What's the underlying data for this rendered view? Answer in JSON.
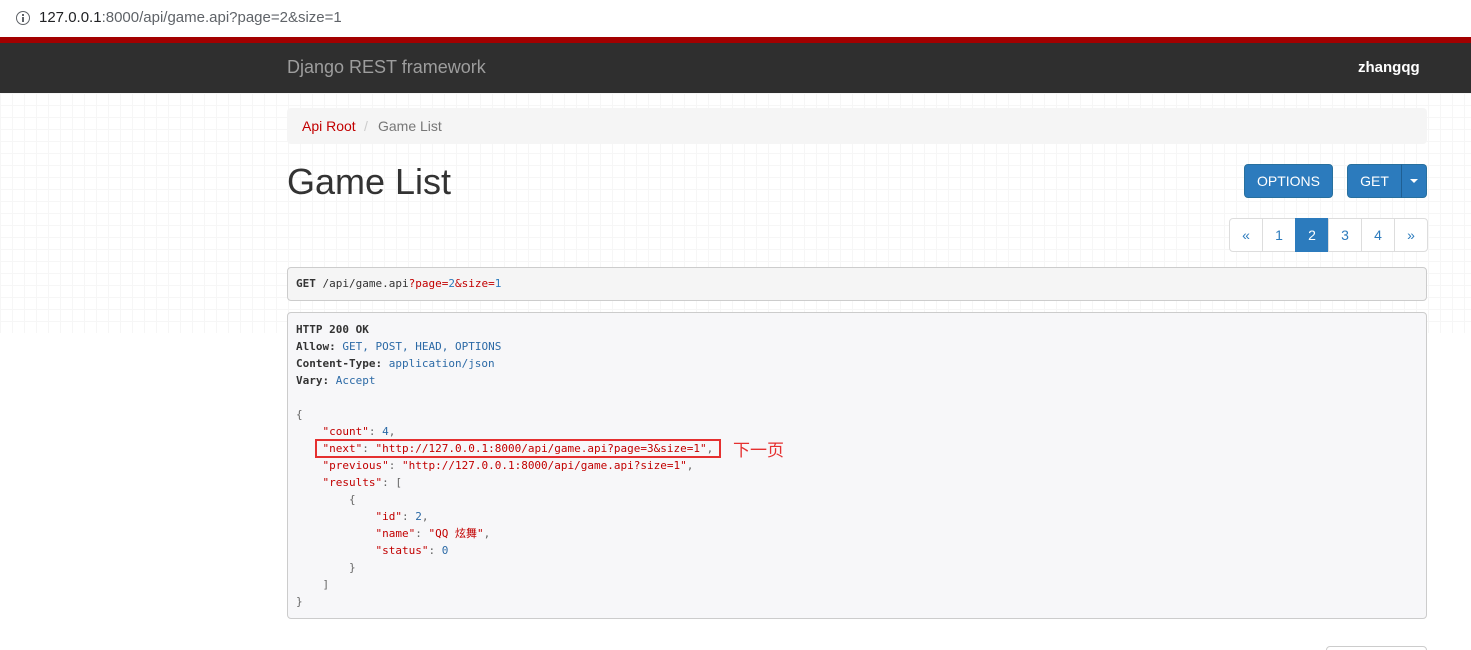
{
  "browser": {
    "url_host": "127.0.0.1",
    "url_rest": ":8000/api/game.api?page=2&size=1"
  },
  "navbar": {
    "brand": "Django REST framework",
    "user": "zhangqg"
  },
  "breadcrumb": {
    "root": "Api Root",
    "separator": "/",
    "current": "Game List"
  },
  "page": {
    "title": "Game List"
  },
  "buttons": {
    "options": "OPTIONS",
    "get": "GET"
  },
  "pagination": {
    "items": [
      "«",
      "1",
      "2",
      "3",
      "4",
      "»"
    ],
    "active": "2"
  },
  "request": {
    "method": "GET",
    "path": "/api/game.api",
    "q1": "?page=",
    "v1": "2",
    "q2": "&size=",
    "v2": "1"
  },
  "response": {
    "status": "HTTP 200 OK",
    "headers": [
      {
        "key": "Allow:",
        "value": "GET, POST, HEAD, OPTIONS"
      },
      {
        "key": "Content-Type:",
        "value": "application/json"
      },
      {
        "key": "Vary:",
        "value": "Accept"
      }
    ],
    "body": {
      "count_key": "\"count\"",
      "count": "4",
      "next_key": "\"next\"",
      "next": "\"http://127.0.0.1:8000/api/game.api?page=3&size=1\"",
      "previous_key": "\"previous\"",
      "previous": "\"http://127.0.0.1:8000/api/game.api?size=1\"",
      "results_key": "\"results\"",
      "id_key": "\"id\"",
      "id": "2",
      "name_key": "\"name\"",
      "name": "\"QQ 炫舞\"",
      "status_key": "\"status\"",
      "status": "0"
    }
  },
  "annotation": {
    "text": "下一页",
    "color": "#e53030"
  }
}
